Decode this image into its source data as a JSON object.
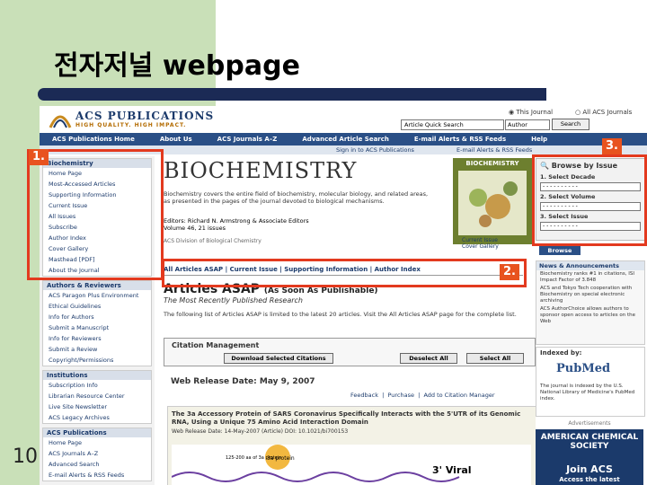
{
  "slide": {
    "title": "전자저널 webpage",
    "number": "10"
  },
  "header": {
    "logo_text": "ACS PUBLICATIONS",
    "tagline": "HIGH QUALITY. HIGH IMPACT.",
    "radio_this": "This Journal",
    "radio_all": "All ACS Journals",
    "quick_search_placeholder": "Article Quick Search",
    "quick_select": "Author",
    "quick_search_button": "Search"
  },
  "nav": {
    "items": [
      "ACS Publications Home",
      "About Us",
      "ACS Journals A–Z",
      "Advanced Article Search",
      "E-mail Alerts & RSS Feeds",
      "Help"
    ]
  },
  "subbar": {
    "signin": "Sign in to ACS Publications",
    "alerts": "E-mail Alerts & RSS Feeds"
  },
  "left": {
    "journal_box": {
      "head": "Biochemistry",
      "items": [
        "Home Page",
        "Most-Accessed Articles",
        "Supporting Information",
        "Current Issue",
        "All Issues",
        "Subscribe",
        "Author Index",
        "Cover Gallery",
        "Masthead [PDF]",
        "About the Journal"
      ]
    },
    "authors_box": {
      "head": "Authors & Reviewers",
      "items": [
        "ACS Paragon Plus Environment",
        "Ethical Guidelines",
        "Info for Authors",
        "Submit a Manuscript",
        "Info for Reviewers",
        "Submit a Review",
        "Copyright/Permissions"
      ]
    },
    "institutions_box": {
      "head": "Institutions",
      "items": [
        "Subscription Info",
        "Librarian Resource Center",
        "Live Site Newsletter",
        "ACS Legacy Archives"
      ]
    },
    "acs_box": {
      "head": "ACS Publications",
      "items": [
        "Home Page",
        "ACS Journals A–Z",
        "Advanced Search",
        "E-mail Alerts & RSS Feeds"
      ]
    }
  },
  "center": {
    "journal_title": "BIOCHEMISTRY",
    "description": "Biochemistry covers the entire field of biochemistry, molecular biology, and related areas, as presented in the pages of the journal devoted to biological mechanisms.",
    "editors": "Editors: Richard N. Armstrong & Associate Editors",
    "volume": "Volume 46, 21 issues",
    "impact": "ACS Division of Biological Chemistry",
    "cover_title": "BIOCHEMISTRY",
    "cover_caption_1": "Current Issue",
    "cover_caption_2": "Cover Gallery",
    "tabs": "All Articles ASAP | Current Issue | Supporting Information | Author Index",
    "asap_title": "Articles ASAP",
    "asap_title_paren": "(As Soon As Publishable)",
    "asap_sub": "The Most Recently Published Research",
    "asap_desc": "The following list of Articles ASAP is limited to the latest 20 articles. Visit the All Articles ASAP page for the complete list.",
    "citation_title": "Citation Management",
    "btn_download": "Download Selected Citations",
    "btn_deselect": "Deselect All",
    "btn_select": "Select All",
    "release": "Web Release Date: May 9, 2007",
    "feedback": "Feedback",
    "purchase": "Purchase",
    "add_citation": "Add to Citation Manager",
    "article_title": "The 3a Accessory Protein of SARS Coronavirus Specifically Interacts with the 5'UTR of its Genomic RNA, Using a Unique 75 Amino Acid Interaction Domain",
    "article_meta": "Web Release Date: 14-May-2007 (Article) DOI: 10.1021/bi700153",
    "diagram_label": "3a protein",
    "diagram_label_2": "125-200 aa of 3a protein",
    "diagram_viral": "3' Viral"
  },
  "right": {
    "browse_head": "Browse by Issue",
    "step1": "1. Select Decade",
    "step2": "2. Select Volume",
    "step3": "3. Select Issue",
    "sel_placeholder": "- - - - - - - - - -",
    "browse_btn": "Browse",
    "news_head": "News & Announcements",
    "news_items": [
      "Biochemistry ranks #1 in citations, ISI Impact Factor of 3.848",
      "ACS and Tokyo Tech cooperation with Biochemistry on special electronic archiving",
      "ACS AuthorChoice allows authors to sponsor open access to articles on the Web"
    ],
    "indexed_head": "Indexed by:",
    "pubmed": "PubMed",
    "indexed_desc": "The journal is indexed by the U.S. National Library of Medicine's PubMed index.",
    "adv": "Advertisements",
    "ad_line1": "AMERICAN CHEMICAL SOCIETY",
    "ad_join": "Join ACS",
    "ad_sub": "Access the latest"
  },
  "annotations": {
    "one": "1.",
    "two": "2.",
    "three": "3."
  },
  "colors": {
    "annotation": "#e33a1f",
    "nav": "#2a4f86",
    "band": "#c9e0b8"
  }
}
